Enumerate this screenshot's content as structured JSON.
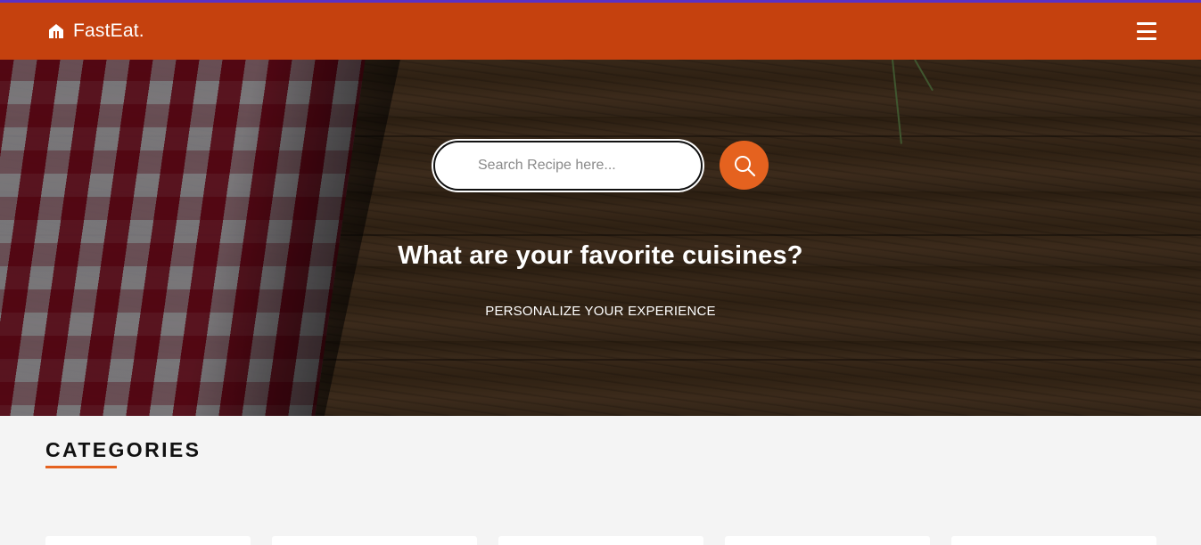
{
  "navbar": {
    "brand_icon": "home-icon",
    "brand_text": "FastEat.",
    "menu_icon": "hamburger-menu-icon",
    "background": "#c5410e"
  },
  "hero": {
    "search": {
      "placeholder": "Search Recipe here...",
      "value": "",
      "button_icon": "search-icon"
    },
    "title": "What are your favorite cuisines?",
    "subtitle": "PERSONALIZE YOUR EXPERIENCE"
  },
  "categories": {
    "heading": "CATEGORIES",
    "accent": "#e5621f"
  }
}
